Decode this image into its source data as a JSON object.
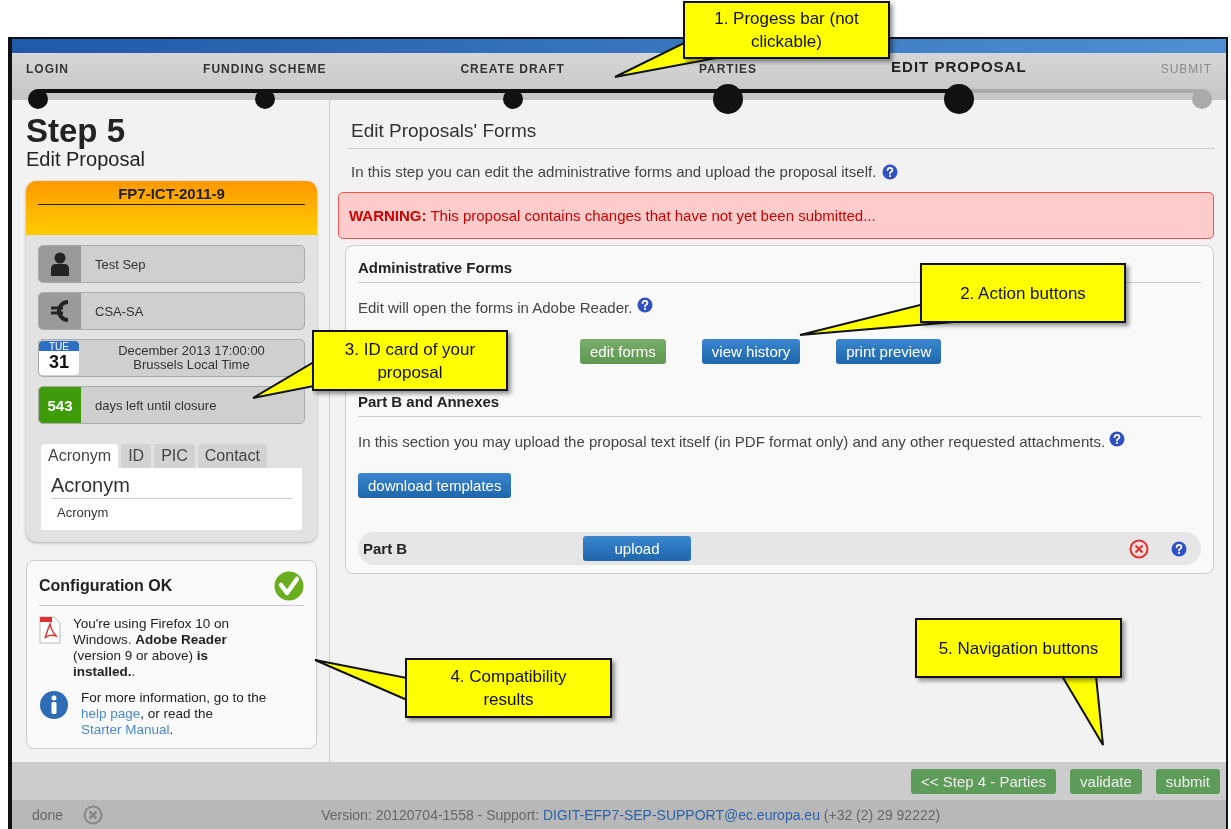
{
  "progress": {
    "steps": [
      {
        "label": "LOGIN",
        "completed": true,
        "selected": false
      },
      {
        "label": "FUNDING SCHEME",
        "completed": true,
        "selected": false
      },
      {
        "label": "CREATE DRAFT",
        "completed": true,
        "selected": false
      },
      {
        "label": "PARTIES",
        "completed": true,
        "selected": false
      },
      {
        "label": "EDIT PROPOSAL",
        "completed": true,
        "selected": true
      },
      {
        "label": "SUBMIT",
        "completed": false,
        "selected": false
      }
    ]
  },
  "sidebar": {
    "step": "Step 5",
    "title": "Edit Proposal",
    "id_card": {
      "call": "FP7-ICT-2011-9",
      "rows": [
        {
          "kind": "person",
          "text": "Test Sep"
        },
        {
          "kind": "euro",
          "text": "CSA-SA"
        },
        {
          "kind": "calendar",
          "weekday": "TUE",
          "day": "31",
          "lines": [
            "December 2013 17:00:00",
            "Brussels Local Time"
          ]
        },
        {
          "kind": "counter",
          "count": "543",
          "text": "days left until closure"
        }
      ],
      "tabs": [
        {
          "label": "Acronym",
          "selected": true
        },
        {
          "label": "ID",
          "selected": false
        },
        {
          "label": "PIC",
          "selected": false
        },
        {
          "label": "Contact",
          "selected": false
        }
      ],
      "tab_content": {
        "heading": "Acronym",
        "value": "Acronym"
      }
    },
    "config": {
      "title": "Configuration OK",
      "items": [
        {
          "kind": "pdf",
          "parts": [
            {
              "text": "You're using Firefox 10 on Windows. **Adobe Reader** (version 9 or above) **is installed.**."
            }
          ]
        },
        {
          "kind": "info",
          "parts": [
            {
              "text": "For more information, go to the "
            },
            {
              "link": "help page"
            },
            {
              "text": ", or read the "
            },
            {
              "link": "Starter Manual"
            },
            {
              "text": "."
            }
          ]
        }
      ]
    }
  },
  "content": {
    "title": "Edit Proposals' Forms",
    "intro": "In this step you can edit the administrative forms and upload the proposal itself.",
    "warning": "**WARNING:** This proposal contains changes that have not yet been submitted...",
    "sections": [
      {
        "kind": "forms",
        "title": "Administrative Forms",
        "text": "Edit will open the forms in Adobe Reader.",
        "buttons": [
          {
            "label": "edit forms",
            "kind": "edit"
          },
          {
            "label": "view history",
            "kind": "default"
          },
          {
            "label": "print preview",
            "kind": "default"
          }
        ]
      },
      {
        "kind": "annexes",
        "title": "Part B and Annexes",
        "text": "In this section you may upload the proposal text itself (in PDF format only) and any other requested attachments.",
        "buttons": [
          {
            "label": "download templates",
            "kind": "default"
          }
        ],
        "uploads": [
          {
            "label": "Part B",
            "button": "upload"
          }
        ]
      }
    ]
  },
  "navigation": [
    {
      "label": "<< Step 4 - Parties"
    },
    {
      "label": "validate"
    },
    {
      "label": "submit"
    }
  ],
  "status_bar": {
    "state": "done",
    "version": "Version: 20120704-1558 - Support: ",
    "email": "DIGIT-EFP7-SEP-SUPPORT@ec.europa.eu",
    "phone": " (+32 (2) 29 92222)"
  },
  "callouts": [
    {
      "text": "1. Progess bar (not clickable)"
    },
    {
      "text": "2. Action buttons"
    },
    {
      "text": "3. ID card of your proposal"
    },
    {
      "text": "4. Compatibility results"
    },
    {
      "text": "5. Navigation buttons"
    }
  ]
}
